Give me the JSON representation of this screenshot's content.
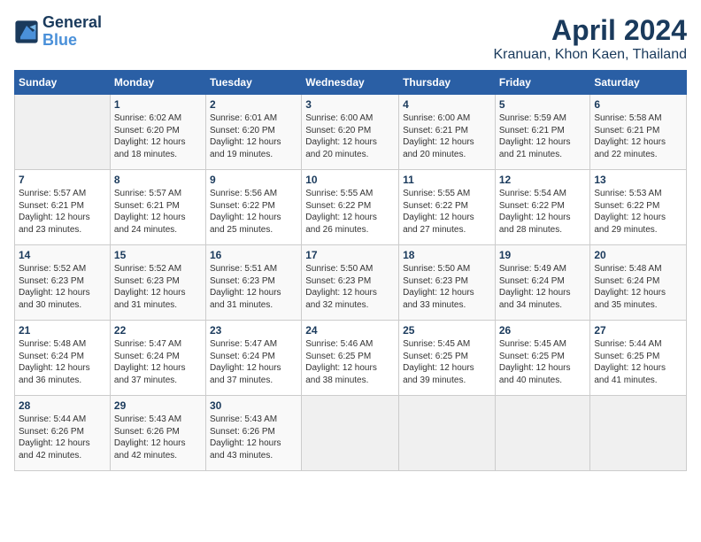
{
  "header": {
    "logo_line1": "General",
    "logo_line2": "Blue",
    "title": "April 2024",
    "subtitle": "Kranuan, Khon Kaen, Thailand"
  },
  "weekdays": [
    "Sunday",
    "Monday",
    "Tuesday",
    "Wednesday",
    "Thursday",
    "Friday",
    "Saturday"
  ],
  "weeks": [
    [
      {
        "day": "",
        "sunrise": "",
        "sunset": "",
        "daylight": ""
      },
      {
        "day": "1",
        "sunrise": "6:02 AM",
        "sunset": "6:20 PM",
        "daylight": "12 hours and 18 minutes."
      },
      {
        "day": "2",
        "sunrise": "6:01 AM",
        "sunset": "6:20 PM",
        "daylight": "12 hours and 19 minutes."
      },
      {
        "day": "3",
        "sunrise": "6:00 AM",
        "sunset": "6:20 PM",
        "daylight": "12 hours and 20 minutes."
      },
      {
        "day": "4",
        "sunrise": "6:00 AM",
        "sunset": "6:21 PM",
        "daylight": "12 hours and 20 minutes."
      },
      {
        "day": "5",
        "sunrise": "5:59 AM",
        "sunset": "6:21 PM",
        "daylight": "12 hours and 21 minutes."
      },
      {
        "day": "6",
        "sunrise": "5:58 AM",
        "sunset": "6:21 PM",
        "daylight": "12 hours and 22 minutes."
      }
    ],
    [
      {
        "day": "7",
        "sunrise": "5:57 AM",
        "sunset": "6:21 PM",
        "daylight": "12 hours and 23 minutes."
      },
      {
        "day": "8",
        "sunrise": "5:57 AM",
        "sunset": "6:21 PM",
        "daylight": "12 hours and 24 minutes."
      },
      {
        "day": "9",
        "sunrise": "5:56 AM",
        "sunset": "6:22 PM",
        "daylight": "12 hours and 25 minutes."
      },
      {
        "day": "10",
        "sunrise": "5:55 AM",
        "sunset": "6:22 PM",
        "daylight": "12 hours and 26 minutes."
      },
      {
        "day": "11",
        "sunrise": "5:55 AM",
        "sunset": "6:22 PM",
        "daylight": "12 hours and 27 minutes."
      },
      {
        "day": "12",
        "sunrise": "5:54 AM",
        "sunset": "6:22 PM",
        "daylight": "12 hours and 28 minutes."
      },
      {
        "day": "13",
        "sunrise": "5:53 AM",
        "sunset": "6:22 PM",
        "daylight": "12 hours and 29 minutes."
      }
    ],
    [
      {
        "day": "14",
        "sunrise": "5:52 AM",
        "sunset": "6:23 PM",
        "daylight": "12 hours and 30 minutes."
      },
      {
        "day": "15",
        "sunrise": "5:52 AM",
        "sunset": "6:23 PM",
        "daylight": "12 hours and 31 minutes."
      },
      {
        "day": "16",
        "sunrise": "5:51 AM",
        "sunset": "6:23 PM",
        "daylight": "12 hours and 31 minutes."
      },
      {
        "day": "17",
        "sunrise": "5:50 AM",
        "sunset": "6:23 PM",
        "daylight": "12 hours and 32 minutes."
      },
      {
        "day": "18",
        "sunrise": "5:50 AM",
        "sunset": "6:23 PM",
        "daylight": "12 hours and 33 minutes."
      },
      {
        "day": "19",
        "sunrise": "5:49 AM",
        "sunset": "6:24 PM",
        "daylight": "12 hours and 34 minutes."
      },
      {
        "day": "20",
        "sunrise": "5:48 AM",
        "sunset": "6:24 PM",
        "daylight": "12 hours and 35 minutes."
      }
    ],
    [
      {
        "day": "21",
        "sunrise": "5:48 AM",
        "sunset": "6:24 PM",
        "daylight": "12 hours and 36 minutes."
      },
      {
        "day": "22",
        "sunrise": "5:47 AM",
        "sunset": "6:24 PM",
        "daylight": "12 hours and 37 minutes."
      },
      {
        "day": "23",
        "sunrise": "5:47 AM",
        "sunset": "6:24 PM",
        "daylight": "12 hours and 37 minutes."
      },
      {
        "day": "24",
        "sunrise": "5:46 AM",
        "sunset": "6:25 PM",
        "daylight": "12 hours and 38 minutes."
      },
      {
        "day": "25",
        "sunrise": "5:45 AM",
        "sunset": "6:25 PM",
        "daylight": "12 hours and 39 minutes."
      },
      {
        "day": "26",
        "sunrise": "5:45 AM",
        "sunset": "6:25 PM",
        "daylight": "12 hours and 40 minutes."
      },
      {
        "day": "27",
        "sunrise": "5:44 AM",
        "sunset": "6:25 PM",
        "daylight": "12 hours and 41 minutes."
      }
    ],
    [
      {
        "day": "28",
        "sunrise": "5:44 AM",
        "sunset": "6:26 PM",
        "daylight": "12 hours and 42 minutes."
      },
      {
        "day": "29",
        "sunrise": "5:43 AM",
        "sunset": "6:26 PM",
        "daylight": "12 hours and 42 minutes."
      },
      {
        "day": "30",
        "sunrise": "5:43 AM",
        "sunset": "6:26 PM",
        "daylight": "12 hours and 43 minutes."
      },
      {
        "day": "",
        "sunrise": "",
        "sunset": "",
        "daylight": ""
      },
      {
        "day": "",
        "sunrise": "",
        "sunset": "",
        "daylight": ""
      },
      {
        "day": "",
        "sunrise": "",
        "sunset": "",
        "daylight": ""
      },
      {
        "day": "",
        "sunrise": "",
        "sunset": "",
        "daylight": ""
      }
    ]
  ]
}
